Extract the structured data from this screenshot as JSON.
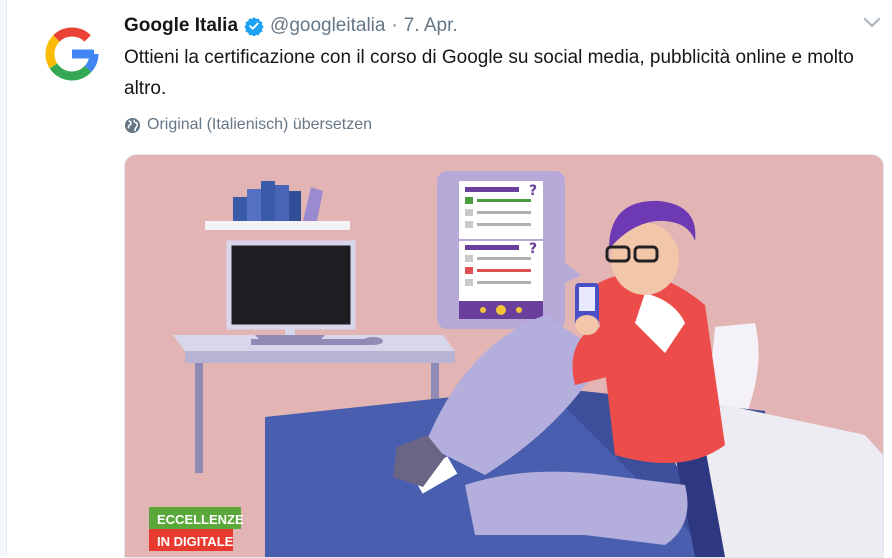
{
  "tweet": {
    "author_name": "Google Italia",
    "handle": "@googleitalia",
    "separator": "·",
    "date": "7. Apr.",
    "text": "Ottieni la certificazione con il corso di Google su social media, pubblicità online e molto altro.",
    "translate_label": "Original (Italienisch) übersetzen"
  },
  "media": {
    "badge_line1": "ECCELLENZE",
    "badge_line2": "IN DIGITALE",
    "quiz_mark_top": "?",
    "quiz_mark_bottom": "?",
    "background_color": "#e3b4b4",
    "shirt_color": "#ec4d4a",
    "bed_color": "#4a5eb0"
  },
  "icons": {
    "avatar": "google-g-logo",
    "verified": "verified-badge-icon",
    "chevron": "chevron-down-icon",
    "globe": "globe-icon"
  },
  "colors": {
    "text": "#14171a",
    "secondary_text": "#657786",
    "verified_blue": "#1da1f2"
  }
}
